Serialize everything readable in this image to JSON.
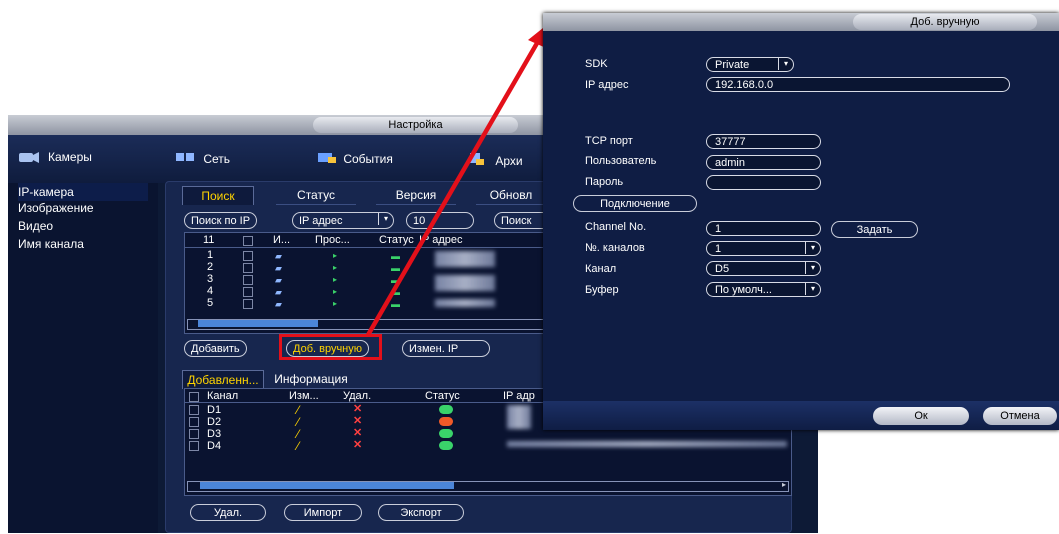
{
  "main_window": {
    "title": "Настройка",
    "sidebar": {
      "header": "Камеры",
      "items": [
        "IP-камера",
        "Изображение",
        "Видео",
        "Имя канала"
      ]
    },
    "nav": [
      "Сеть",
      "События",
      "Архи"
    ],
    "subtabs": [
      "Поиск",
      "Статус",
      "Версия",
      "Обновл"
    ],
    "toolbar": {
      "search_by_ip": "Поиск по IP",
      "ip_address": "IP адрес",
      "count_field": "10",
      "search_btn": "Поиск"
    },
    "search_table": {
      "headers": [
        "11",
        "И...",
        "Прос...",
        "Статус",
        "IP адрес"
      ],
      "rows": [
        "1",
        "2",
        "3",
        "4",
        "5"
      ]
    },
    "actions": {
      "add": "Добавить",
      "manual_add": "Доб. вручную",
      "change_ip": "Измен. IP"
    },
    "lower_tabs": [
      "Добавленн...",
      "Информация"
    ],
    "added_table": {
      "headers": [
        "Канал",
        "Изм...",
        "Удал.",
        "Статус",
        "IP адр"
      ],
      "rows": [
        {
          "channel": "D1",
          "status_color": "#3ad36a"
        },
        {
          "channel": "D2",
          "status_color": "#f05a28"
        },
        {
          "channel": "D3",
          "status_color": "#3ad36a"
        },
        {
          "channel": "D4",
          "status_color": "#3ad36a"
        }
      ]
    },
    "bottom_buttons": [
      "Удал.",
      "Импорт",
      "Экспорт"
    ]
  },
  "dialog": {
    "title": "Доб. вручную",
    "sdk_label": "SDK",
    "sdk_value": "Private",
    "ip_label": "IP адрес",
    "ip_value": "192.168.0.0",
    "tcp_label": "TCP порт",
    "tcp_value": "37777",
    "user_label": "Пользователь",
    "user_value": "admin",
    "password_label": "Пароль",
    "password_value": "",
    "connect_btn": "Подключение",
    "channel_no_label": "Channel No.",
    "channel_no_value": "1",
    "set_btn": "Задать",
    "channels_count_label": "№. каналов",
    "channels_count_value": "1",
    "channel_label": "Канал",
    "channel_value": "D5",
    "buffer_label": "Буфер",
    "buffer_value": "По умолч...",
    "ok_btn": "Ок",
    "cancel_btn": "Отмена"
  },
  "colors": {
    "accent_highlight": "#ffd400",
    "arrow_red": "#e3101a"
  }
}
